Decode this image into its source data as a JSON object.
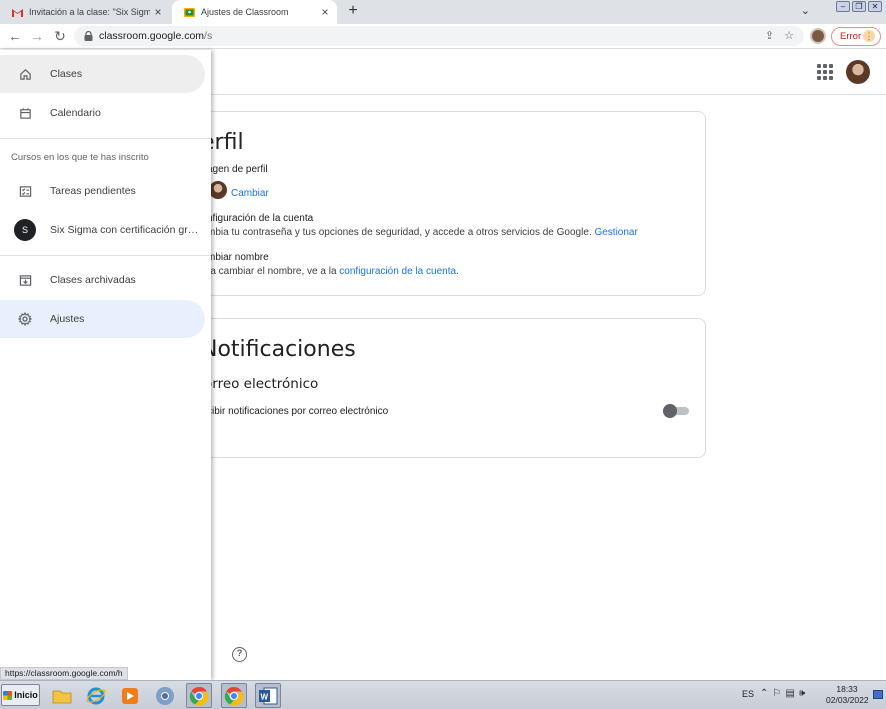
{
  "browser": {
    "tabs": [
      {
        "title": "Invitación a la clase: \"Six Sigma con",
        "icon": "gmail-icon",
        "active": false
      },
      {
        "title": "Ajustes de Classroom",
        "icon": "classroom-icon",
        "active": true
      }
    ],
    "new_tab": "+",
    "url_host": "classroom.google.com",
    "url_path": "/s",
    "error_label": "Error",
    "status_url": "https://classroom.google.com/h"
  },
  "drawer": {
    "items_top": [
      {
        "label": "Clases",
        "icon": "home-icon"
      },
      {
        "label": "Calendario",
        "icon": "calendar-icon"
      }
    ],
    "section_title": "Cursos en los que te has inscrito",
    "enrolled": [
      {
        "label": "Tareas pendientes",
        "icon": "todo-icon"
      },
      {
        "label": "Six Sigma con certificación gr…",
        "avatar_letter": "S"
      }
    ],
    "items_bottom": [
      {
        "label": "Clases archivadas",
        "icon": "archive-icon"
      },
      {
        "label": "Ajustes",
        "icon": "gear-icon"
      }
    ]
  },
  "profile": {
    "title": "erfil",
    "picture_label": "agen de perfil",
    "change_link": "Cambiar",
    "account_heading": "nfiguración de la cuenta",
    "account_text": "mbia tu contraseña y tus opciones de seguridad, y accede a otros servicios de Google.",
    "manage_link": "Gestionar",
    "name_heading": "mbiar nombre",
    "name_text": "ra cambiar el nombre, ve a la",
    "name_link": "configuración de la cuenta",
    "name_suffix": "."
  },
  "notifications": {
    "title": "Notificaciones",
    "email_heading": "orreo electrónico",
    "email_toggle_label": "cibir notificaciones por correo electrónico",
    "email_toggle_on": false
  },
  "help": "?",
  "taskbar": {
    "start_label": "Inicio",
    "lang": "ES",
    "time": "18:33",
    "date": "02/03/2022"
  },
  "colors": {
    "link": "#1a73e8",
    "selected": "#e8f0fe"
  }
}
